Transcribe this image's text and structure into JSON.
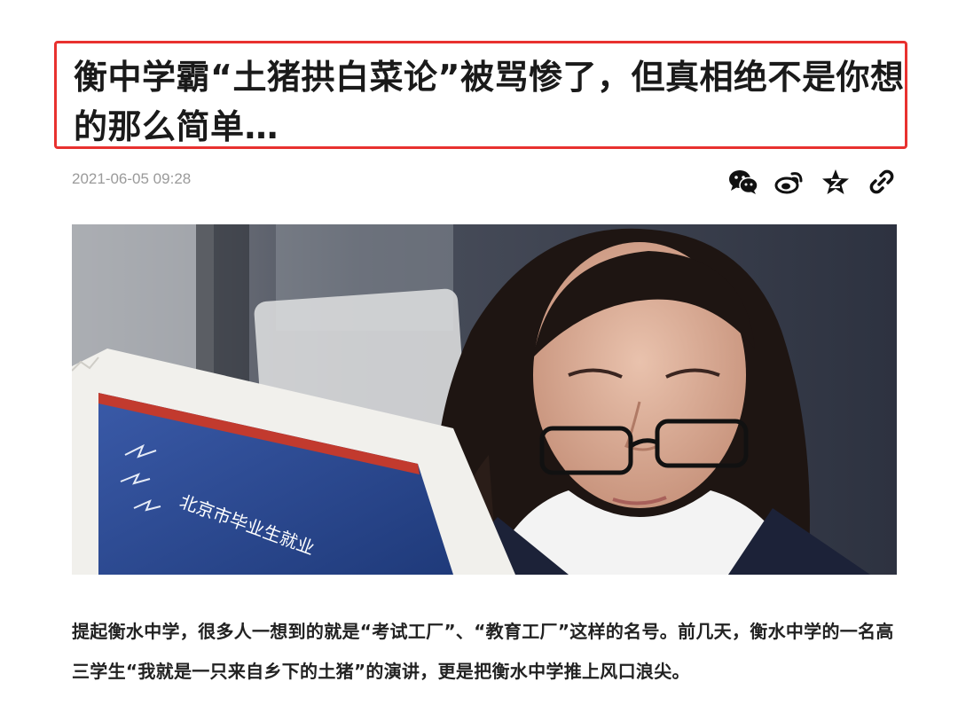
{
  "article": {
    "title": "衡中学霸“土猪拱白菜论”被骂惨了，但真相绝不是你想的那么简单…",
    "timestamp": "2021-06-05 09:28",
    "share_icons": [
      {
        "name": "wechat-icon"
      },
      {
        "name": "weibo-icon"
      },
      {
        "name": "favorite-star-icon"
      },
      {
        "name": "link-icon"
      }
    ],
    "hero_image": {
      "newspaper_headline": "北京市毕业生就业"
    },
    "paragraph": "提起衡水中学，很多人一想到的就是“考试工厂”、“教育工厂”这样的名号。前几天，衡水中学的一名高三学生“我就是一只来自乡下的土猪”的演讲，更是把衡水中学推上风口浪尖。"
  },
  "colors": {
    "title_border": "#e8312f",
    "timestamp": "#9a9a9a",
    "icon": "#111111"
  }
}
